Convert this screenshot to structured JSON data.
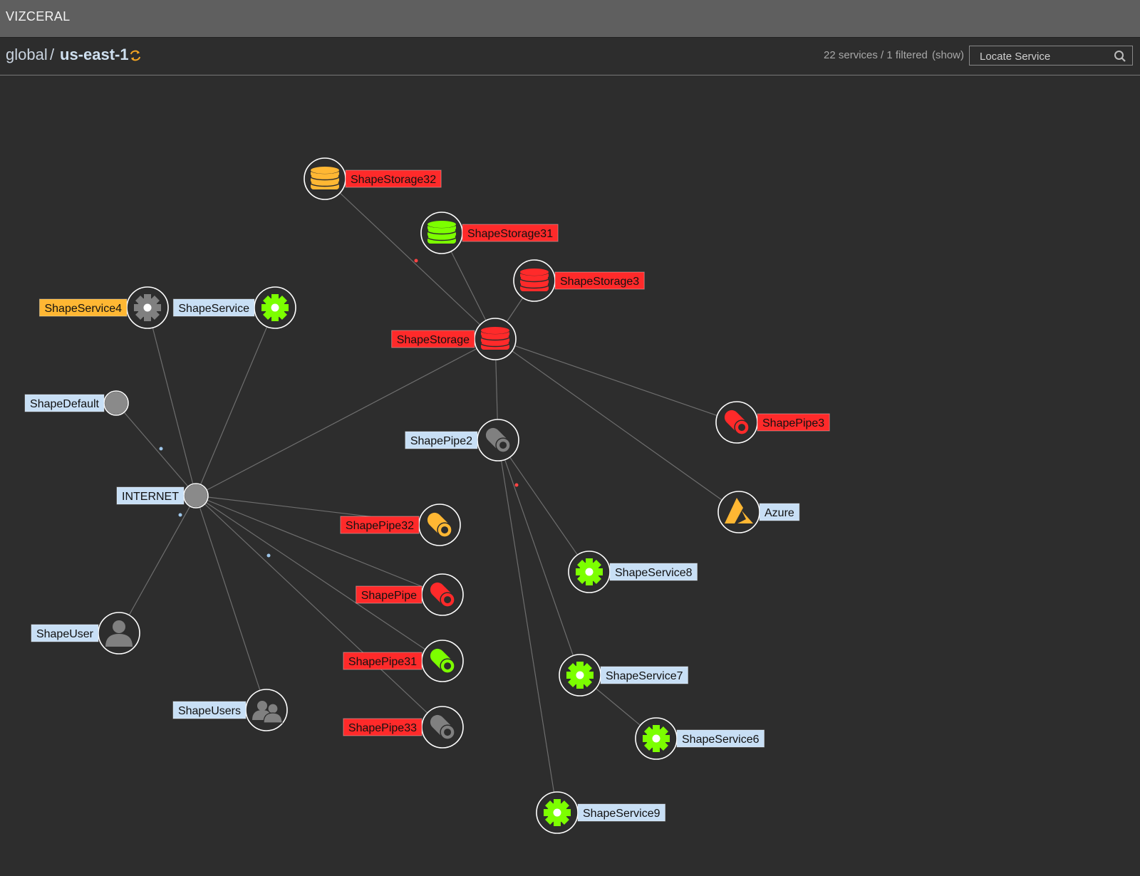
{
  "app": {
    "title": "VIZCERAL"
  },
  "breadcrumb": {
    "root": "global",
    "separator": "/",
    "region": "us-east-1"
  },
  "status": {
    "services_text": "22 services / 1 filtered",
    "show_link": "(show)"
  },
  "search": {
    "placeholder": "Locate Service"
  },
  "colors": {
    "red": "#ff2a2a",
    "green": "#7cff00",
    "orange": "#ffb733",
    "gray": "#808080",
    "label_blue": "#c8dff5",
    "background": "#2d2d2d",
    "node_ring": "#ffffff"
  },
  "nodes": [
    {
      "id": "storage32",
      "label": "ShapeStorage32",
      "icon": "database-icon",
      "icon_color": "orange",
      "label_style": "red"
    },
    {
      "id": "storage31",
      "label": "ShapeStorage31",
      "icon": "database-icon",
      "icon_color": "green",
      "label_style": "red"
    },
    {
      "id": "storage3",
      "label": "ShapeStorage3",
      "icon": "database-icon",
      "icon_color": "red",
      "label_style": "red"
    },
    {
      "id": "storage",
      "label": "ShapeStorage",
      "icon": "database-icon",
      "icon_color": "red",
      "label_style": "red"
    },
    {
      "id": "service4",
      "label": "ShapeService4",
      "icon": "gear-icon",
      "icon_color": "gray",
      "label_style": "orange"
    },
    {
      "id": "service",
      "label": "ShapeService",
      "icon": "gear-icon",
      "icon_color": "green",
      "label_style": "blue"
    },
    {
      "id": "default",
      "label": "ShapeDefault",
      "icon": "circle-icon",
      "icon_color": "gray",
      "label_style": "blue"
    },
    {
      "id": "internet",
      "label": "INTERNET",
      "icon": "circle-icon",
      "icon_color": "gray",
      "label_style": "blue"
    },
    {
      "id": "user",
      "label": "ShapeUser",
      "icon": "user-icon",
      "icon_color": "gray",
      "label_style": "blue"
    },
    {
      "id": "users",
      "label": "ShapeUsers",
      "icon": "users-icon",
      "icon_color": "gray",
      "label_style": "blue"
    },
    {
      "id": "pipe2",
      "label": "ShapePipe2",
      "icon": "pipe-icon",
      "icon_color": "gray",
      "label_style": "blue"
    },
    {
      "id": "pipe3",
      "label": "ShapePipe3",
      "icon": "pipe-icon",
      "icon_color": "red",
      "label_style": "red"
    },
    {
      "id": "azure",
      "label": "Azure",
      "icon": "azure-icon",
      "icon_color": "orange",
      "label_style": "blue"
    },
    {
      "id": "pipe32",
      "label": "ShapePipe32",
      "icon": "pipe-icon",
      "icon_color": "orange",
      "label_style": "red"
    },
    {
      "id": "pipe",
      "label": "ShapePipe",
      "icon": "pipe-icon",
      "icon_color": "red",
      "label_style": "red"
    },
    {
      "id": "pipe31",
      "label": "ShapePipe31",
      "icon": "pipe-icon",
      "icon_color": "green",
      "label_style": "red"
    },
    {
      "id": "pipe33",
      "label": "ShapePipe33",
      "icon": "pipe-icon",
      "icon_color": "gray",
      "label_style": "red"
    },
    {
      "id": "service8",
      "label": "ShapeService8",
      "icon": "gear-icon",
      "icon_color": "green",
      "label_style": "blue"
    },
    {
      "id": "service7",
      "label": "ShapeService7",
      "icon": "gear-icon",
      "icon_color": "green",
      "label_style": "blue"
    },
    {
      "id": "service6",
      "label": "ShapeService6",
      "icon": "gear-icon",
      "icon_color": "green",
      "label_style": "blue"
    },
    {
      "id": "service9",
      "label": "ShapeService9",
      "icon": "gear-icon",
      "icon_color": "green",
      "label_style": "blue"
    }
  ],
  "edges": [
    [
      "internet",
      "service4"
    ],
    [
      "internet",
      "service"
    ],
    [
      "internet",
      "default"
    ],
    [
      "internet",
      "user"
    ],
    [
      "internet",
      "users"
    ],
    [
      "internet",
      "storage"
    ],
    [
      "internet",
      "pipe32"
    ],
    [
      "internet",
      "pipe"
    ],
    [
      "internet",
      "pipe31"
    ],
    [
      "internet",
      "pipe33"
    ],
    [
      "storage",
      "storage32"
    ],
    [
      "storage",
      "storage31"
    ],
    [
      "storage",
      "storage3"
    ],
    [
      "storage",
      "pipe2"
    ],
    [
      "storage",
      "pipe3"
    ],
    [
      "storage",
      "azure"
    ],
    [
      "pipe2",
      "service8"
    ],
    [
      "pipe2",
      "service7"
    ],
    [
      "pipe2",
      "service9"
    ],
    [
      "service7",
      "service6"
    ]
  ]
}
